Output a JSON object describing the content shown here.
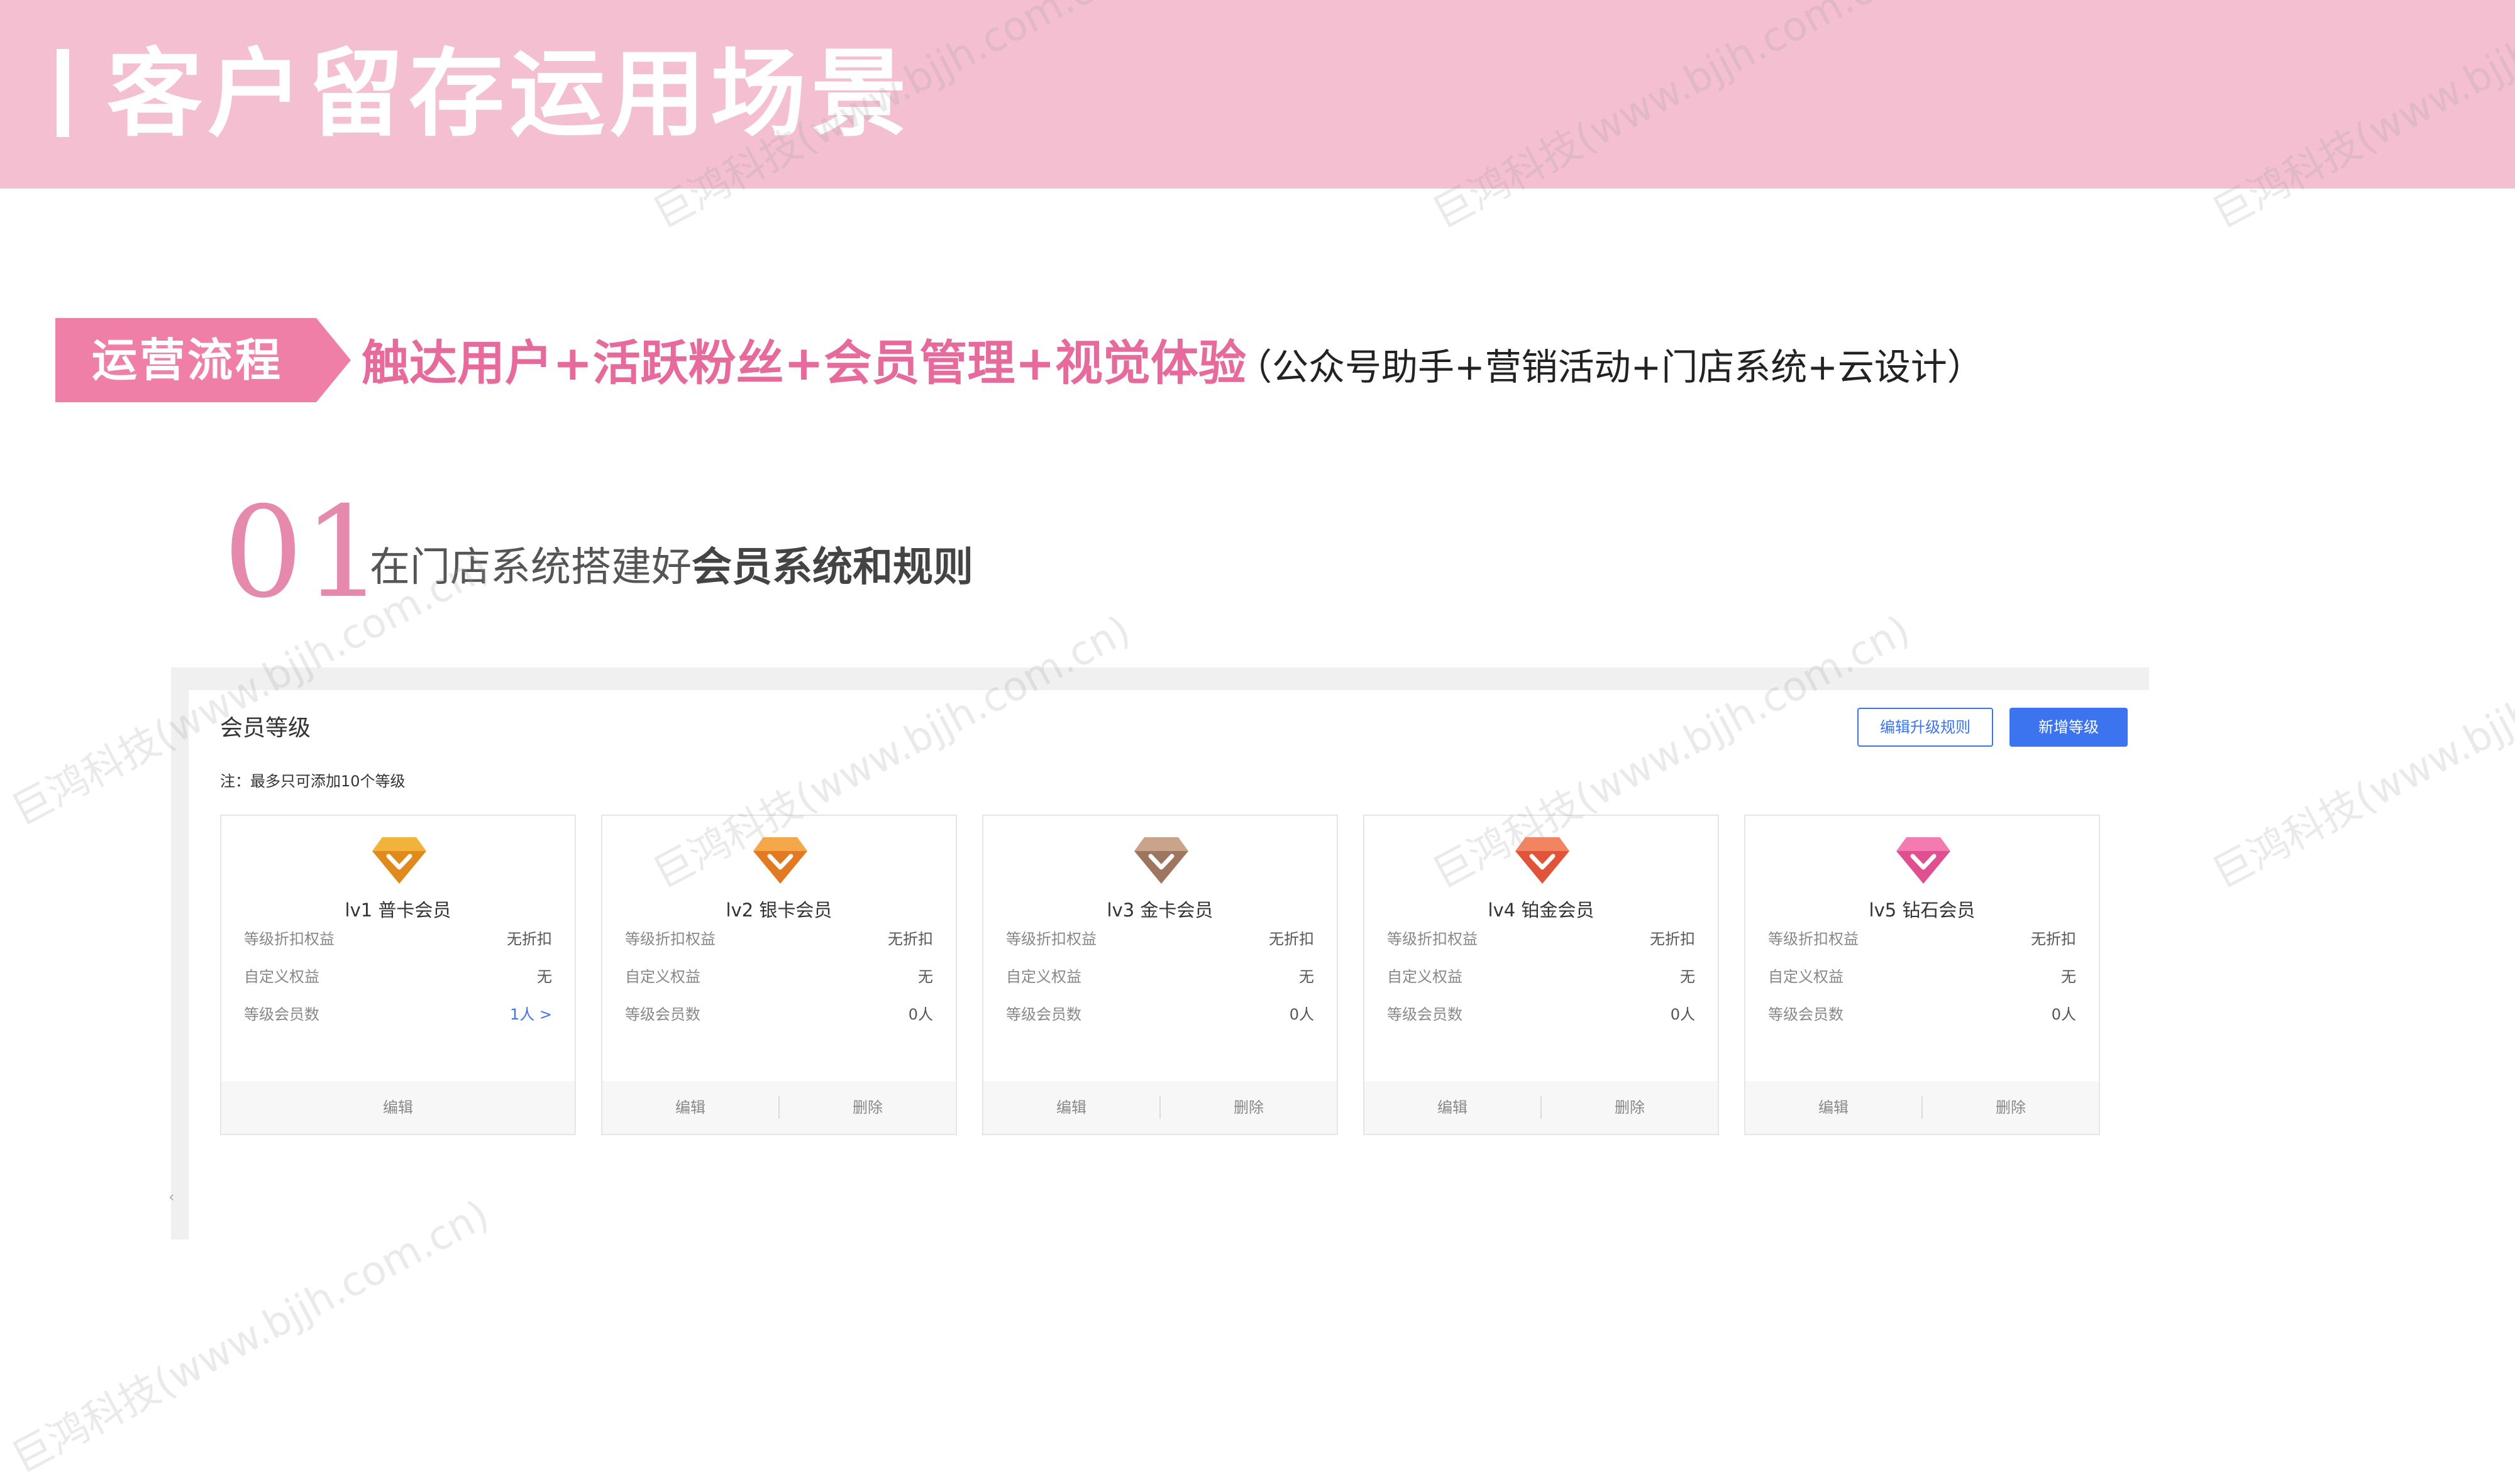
{
  "header": {
    "title": "客户留存运用场景"
  },
  "flow": {
    "tag": "运营流程",
    "main": "触达用户+活跃粉丝+会员管理+视觉体验",
    "sub": "（公众号助手+营销活动+门店系统+云设计）"
  },
  "step": {
    "number": "01",
    "text_prefix": "在门店系统搭建好",
    "text_bold": "会员系统和规则"
  },
  "panel": {
    "title": "会员等级",
    "note": "注：最多只可添加10个等级",
    "edit_rule_button": "编辑升级规则",
    "add_level_button": "新增等级",
    "row_labels": [
      "等级折扣权益",
      "自定义权益",
      "等级会员数"
    ],
    "edit_label": "编辑",
    "delete_label": "删除",
    "levels": [
      {
        "name": "lv1 普卡会员",
        "discount": "无折扣",
        "custom": "无",
        "members": "1人 >",
        "gem_color": "#f2b33a",
        "gem_dark": "#e08a1e"
      },
      {
        "name": "lv2 银卡会员",
        "discount": "无折扣",
        "custom": "无",
        "members": "0人",
        "gem_color": "#f4a84a",
        "gem_dark": "#e27a23"
      },
      {
        "name": "lv3 金卡会员",
        "discount": "无折扣",
        "custom": "无",
        "members": "0人",
        "gem_color": "#c9a48a",
        "gem_dark": "#9e7660"
      },
      {
        "name": "lv4 铂金会员",
        "discount": "无折扣",
        "custom": "无",
        "members": "0人",
        "gem_color": "#f28461",
        "gem_dark": "#e0553a"
      },
      {
        "name": "lv5 钻石会员",
        "discount": "无折扣",
        "custom": "无",
        "members": "0人",
        "gem_color": "#f37bb0",
        "gem_dark": "#e04f90"
      }
    ]
  },
  "watermark": "巨鸿科技(www.bjjh.com.cn)",
  "colors": {
    "header_band": "#f4bfd0",
    "accent_pink": "#e66a9b",
    "primary_blue": "#3b74ee"
  }
}
